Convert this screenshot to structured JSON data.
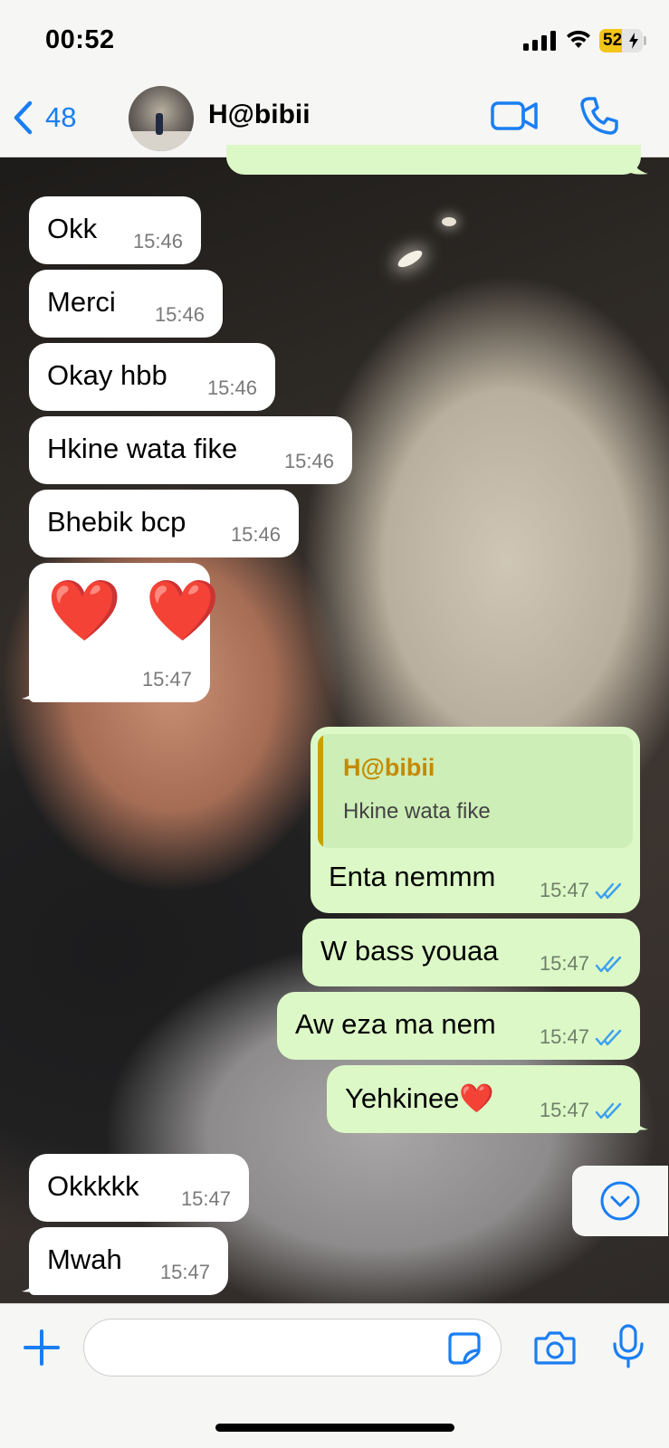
{
  "status_bar": {
    "time": "00:52",
    "battery_percent": 52,
    "battery_label": "52",
    "battery_color": "#f2c518"
  },
  "header": {
    "back_count": "48",
    "contact_name": "H@bibii",
    "accent_color": "#1a7ef2"
  },
  "messages": [
    {
      "direction": "in",
      "text": "Okk",
      "time": "15:46"
    },
    {
      "direction": "in",
      "text": "Merci",
      "time": "15:46"
    },
    {
      "direction": "in",
      "text": "Okay hbb",
      "time": "15:46"
    },
    {
      "direction": "in",
      "text": "Hkine wata fike",
      "time": "15:46"
    },
    {
      "direction": "in",
      "text": "Bhebik bcp",
      "time": "15:46"
    },
    {
      "direction": "in",
      "text": "❤️ ❤️",
      "time": "15:47"
    },
    {
      "direction": "out",
      "text": "Enta nemmm",
      "time": "15:47",
      "reply_to": {
        "author": "H@bibii",
        "text": "Hkine wata fike"
      },
      "status": "read"
    },
    {
      "direction": "out",
      "text": "W bass youaa",
      "time": "15:47",
      "status": "read"
    },
    {
      "direction": "out",
      "text": "Aw eza ma nem",
      "time": "15:47",
      "status": "read"
    },
    {
      "direction": "out",
      "text": "Yehkinee❤️",
      "time": "15:47",
      "status": "read"
    },
    {
      "direction": "in",
      "text": "Okkkkk",
      "time": "15:47"
    },
    {
      "direction": "in",
      "text": "Mwah",
      "time": "15:47"
    }
  ],
  "composer": {
    "placeholder": ""
  },
  "icons": [
    "chevron-left-icon",
    "video-camera-icon",
    "phone-icon",
    "chevron-down-circle-icon",
    "plus-icon",
    "sticker-icon",
    "camera-icon",
    "microphone-icon",
    "double-check-icon"
  ],
  "colors": {
    "incoming_bubble": "#ffffff",
    "outgoing_bubble": "#dcf8c6",
    "read_ticks": "#3b9ff2",
    "reply_author": "#c48a00"
  }
}
